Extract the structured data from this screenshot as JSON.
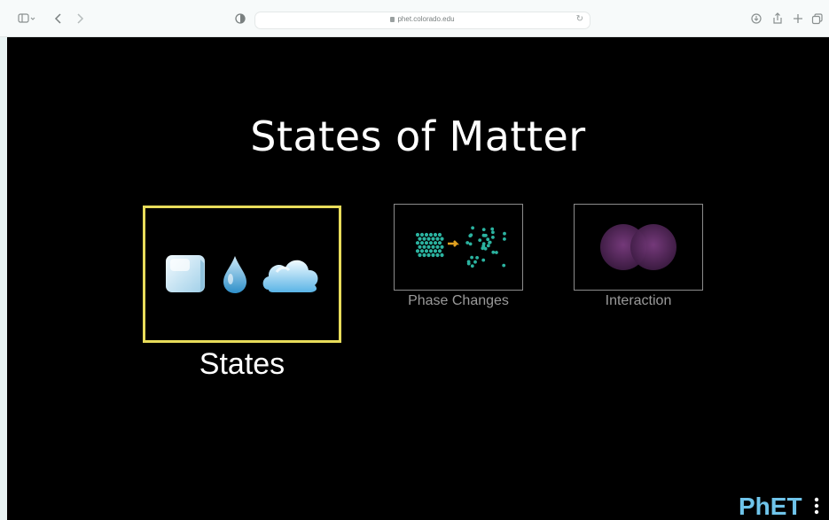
{
  "browser": {
    "url": "phet.colorado.edu"
  },
  "sim": {
    "title": "States of Matter",
    "screens": [
      {
        "label": "States",
        "selected": true
      },
      {
        "label": "Phase Changes",
        "selected": false
      },
      {
        "label": "Interaction",
        "selected": false
      }
    ],
    "logo_text": "PhET"
  },
  "colors": {
    "selection": "#e8dc5a",
    "particle": "#2bb3a0",
    "arrow": "#e0a020",
    "atom": "#5a2a5e"
  }
}
